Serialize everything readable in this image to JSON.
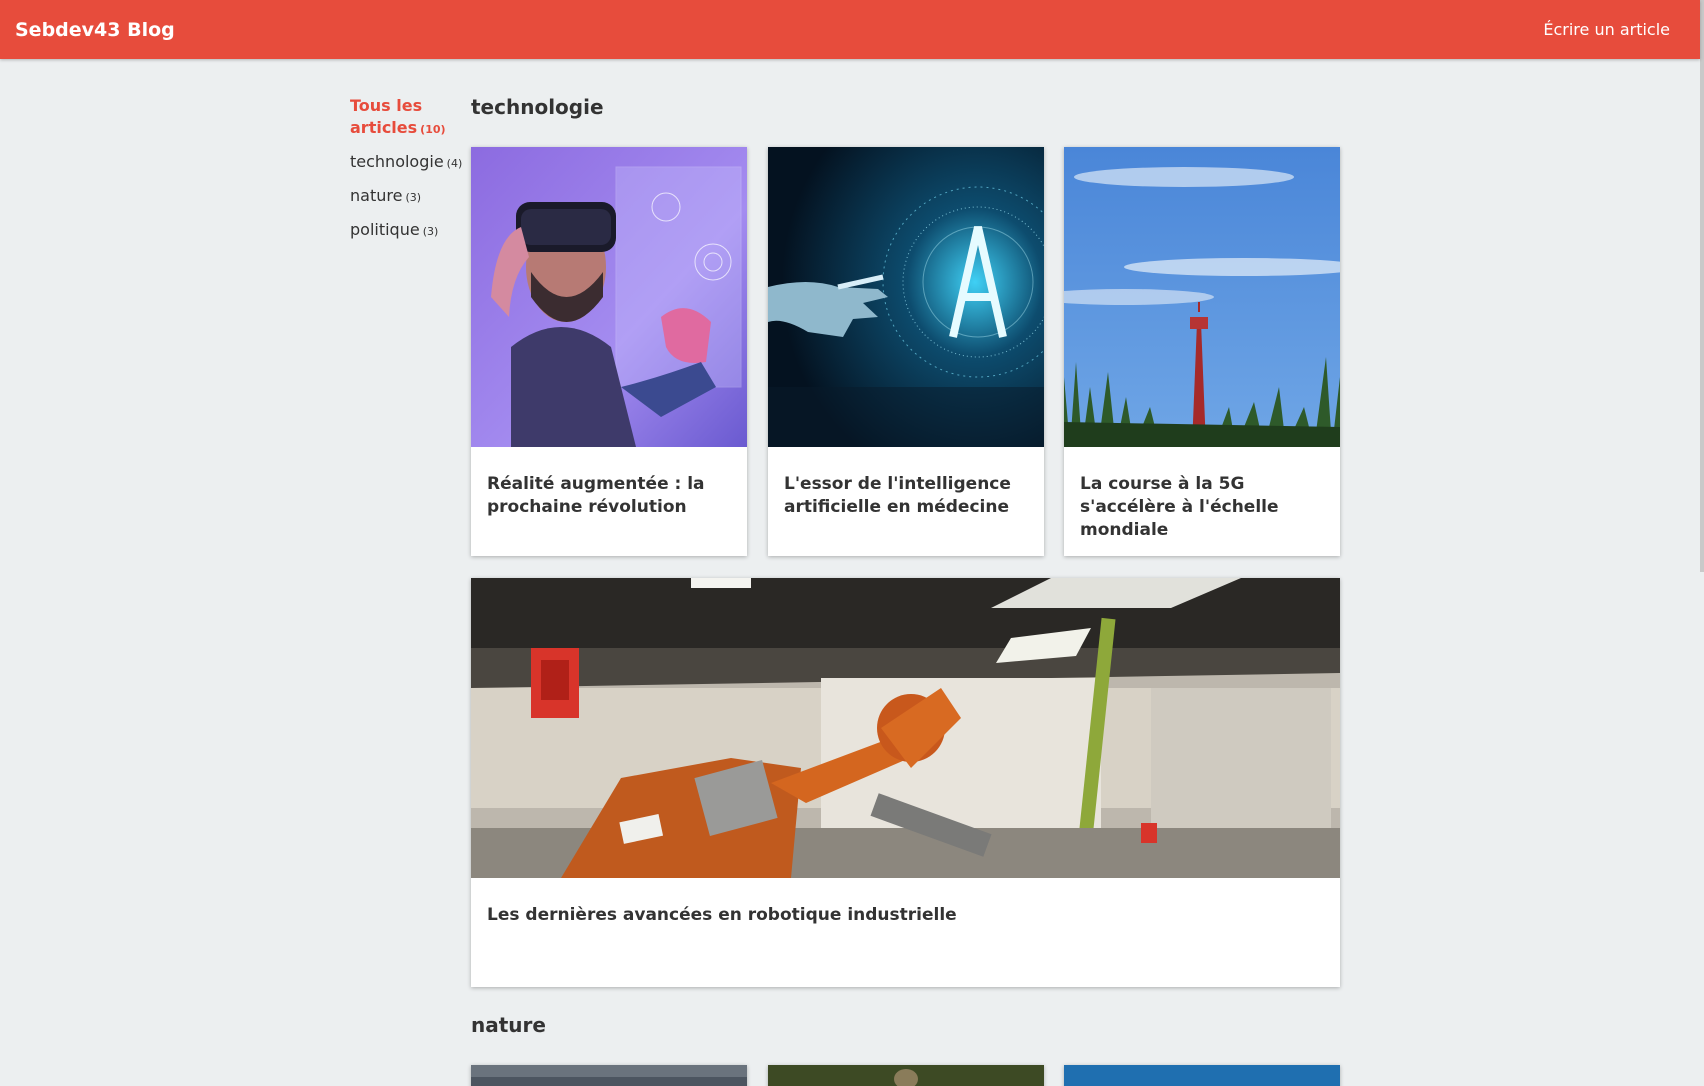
{
  "navbar": {
    "brand": "Sebdev43 Blog",
    "write_link": "Écrire un article"
  },
  "sidebar": {
    "items": [
      {
        "label": "Tous les articles",
        "count": "(10)",
        "active": true
      },
      {
        "label": "technologie",
        "count": "(4)",
        "active": false
      },
      {
        "label": "nature",
        "count": "(3)",
        "active": false
      },
      {
        "label": "politique",
        "count": "(3)",
        "active": false
      }
    ]
  },
  "sections": [
    {
      "title": "technologie",
      "articles": [
        {
          "title": "Réalité augmentée : la prochaine révolution",
          "image": "vr-headset-photo"
        },
        {
          "title": "L'essor de l'intelligence artificielle en médecine",
          "image": "ai-hand-photo"
        },
        {
          "title": "La course à la 5G s'accélère à l'échelle mondiale",
          "image": "antenna-tower-photo"
        },
        {
          "title": "Les dernières avancées en robotique industrielle",
          "image": "industrial-robot-photo"
        }
      ]
    },
    {
      "title": "nature",
      "articles": []
    }
  ],
  "colors": {
    "accent": "#e74c3c",
    "background": "#eceff0",
    "card": "#ffffff",
    "text": "#333333"
  }
}
